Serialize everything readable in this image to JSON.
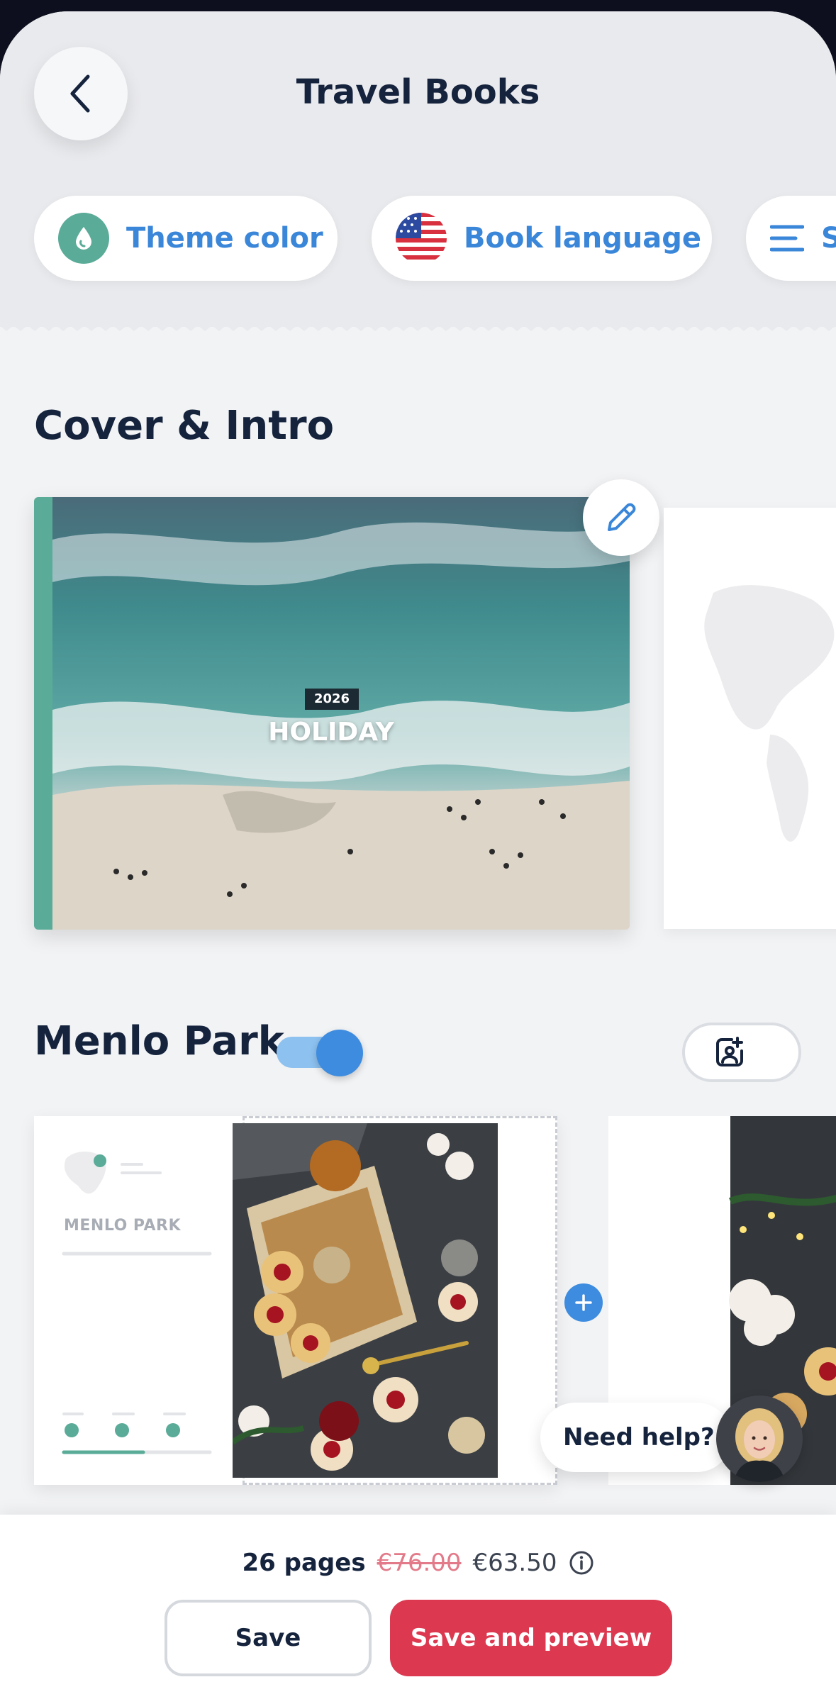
{
  "header": {
    "title": "Travel Books",
    "back_icon": "chevron-left-icon"
  },
  "options": [
    {
      "label": "Theme color",
      "icon": "drop-icon",
      "color": "#5aab98"
    },
    {
      "label": "Book language",
      "icon": "us-flag-icon"
    },
    {
      "label": "S",
      "icon": "menu-lines-icon"
    }
  ],
  "sections": {
    "cover": {
      "title": "Cover & Intro",
      "cover_year": "2026",
      "cover_title": "HOLIDAY",
      "edit_icon": "pencil-icon"
    },
    "chapter": {
      "title": "Menlo Park",
      "toggle_on": true,
      "intro_heading": "MENLO PARK",
      "add_photo_icon": "add-photo-icon",
      "add_page_icon": "plus-icon"
    }
  },
  "help": {
    "label": "Need help?"
  },
  "footer": {
    "pages": "26 pages",
    "old_price": "€76.00",
    "new_price": "€63.50",
    "save_label": "Save",
    "preview_label": "Save and preview"
  },
  "colors": {
    "accent": "#3a86d9",
    "theme": "#5aab98",
    "primary_button": "#dc3951"
  }
}
